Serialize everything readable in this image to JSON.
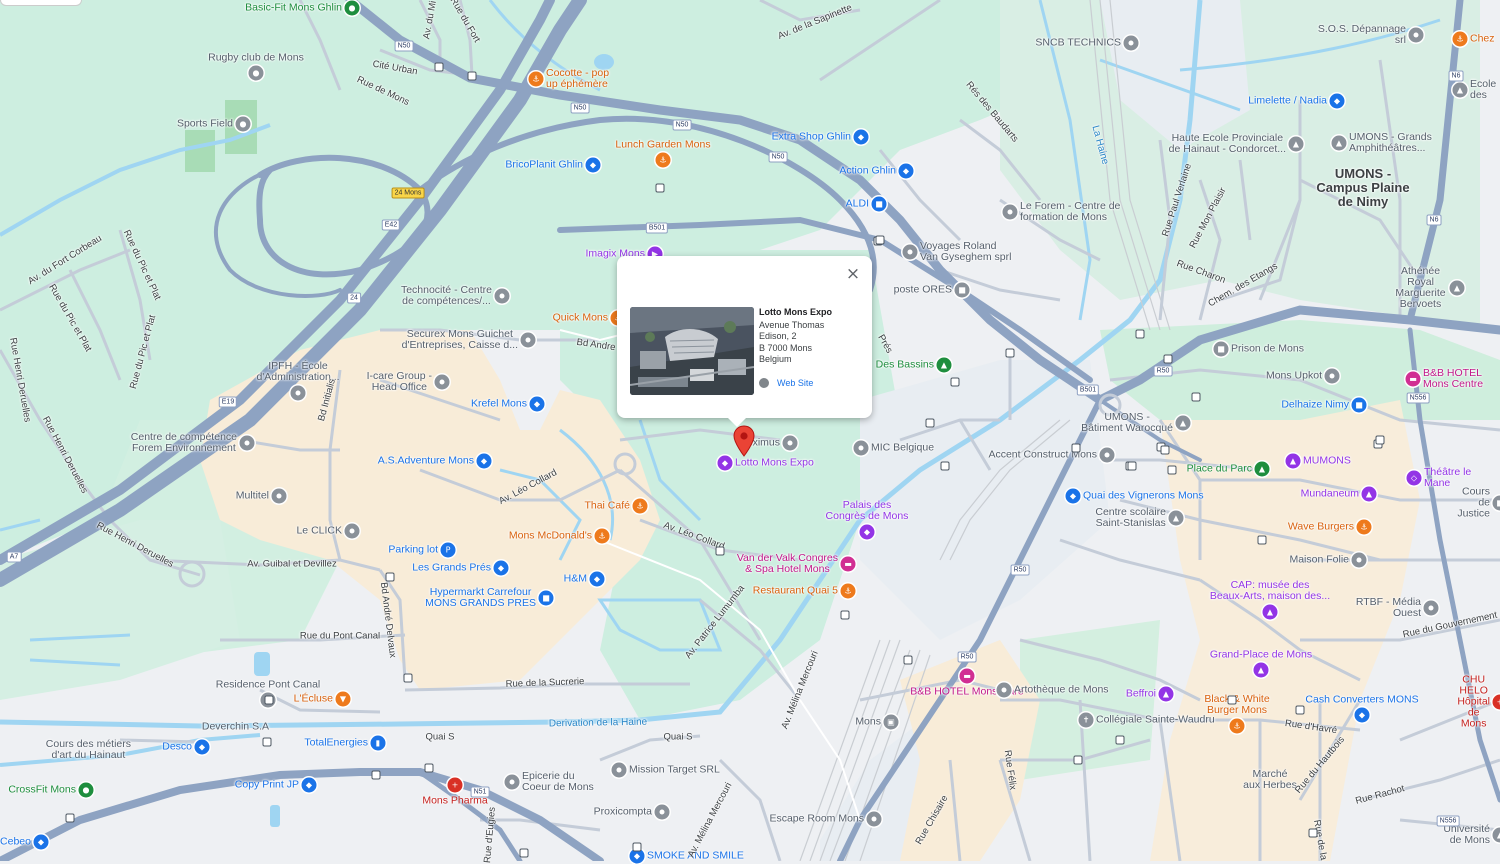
{
  "popup": {
    "title": "Lotto Mons Expo",
    "address_lines": [
      "Avenue Thomas",
      "Edison, 2",
      "B 7000 Mons",
      "Belgium"
    ],
    "web_label": "Web Site",
    "close_symbol": "×"
  },
  "pois": [
    {
      "id": "basic-fit",
      "text": [
        "Basic-Fit Mons Ghlin"
      ],
      "color": "green",
      "icon": "gym-icon"
    },
    {
      "id": "rugby",
      "text": [
        "Rugby club de Mons"
      ],
      "color": "gray",
      "icon": "sports-icon"
    },
    {
      "id": "sports-field",
      "text": [
        "Sports Field"
      ],
      "color": "gray",
      "icon": "sports-icon"
    },
    {
      "id": "cocotte",
      "text": [
        "Cocotte - pop",
        "up éphémère"
      ],
      "color": "orange",
      "icon": "restaurant-icon"
    },
    {
      "id": "lunch-garden",
      "text": [
        "Lunch Garden Mons"
      ],
      "color": "orange",
      "icon": "restaurant-icon"
    },
    {
      "id": "bricoplanit",
      "text": [
        "BricoPlanit Ghlin"
      ],
      "color": "blue",
      "icon": "shopping-icon"
    },
    {
      "id": "extra-shop",
      "text": [
        "Extra Shop Ghlin"
      ],
      "color": "blue",
      "icon": "shopping-icon"
    },
    {
      "id": "action-ghlin",
      "text": [
        "Action Ghlin"
      ],
      "color": "blue",
      "icon": "shopping-icon"
    },
    {
      "id": "aldi",
      "text": [
        "ALDI"
      ],
      "color": "blue",
      "icon": "cart-icon"
    },
    {
      "id": "sncb-technics",
      "text": [
        "SNCB TECHNICS"
      ],
      "color": "gray",
      "icon": "place-icon"
    },
    {
      "id": "sos-depannage",
      "text": [
        "S.O.S. Dépannage srl"
      ],
      "color": "gray",
      "icon": "place-icon"
    },
    {
      "id": "chez",
      "text": [
        "Chez"
      ],
      "color": "orange",
      "icon": "restaurant-icon"
    },
    {
      "id": "ecole",
      "text": [
        "Ecole",
        "des"
      ],
      "color": "gray",
      "icon": "school-icon"
    },
    {
      "id": "limelette",
      "text": [
        "Limelette / Nadia"
      ],
      "color": "blue",
      "icon": "shopping-icon"
    },
    {
      "id": "haute-ecole",
      "text": [
        "Haute Ecole Provinciale",
        "de Hainaut - Condorcet..."
      ],
      "color": "gray",
      "icon": "school-icon"
    },
    {
      "id": "umons-grands",
      "text": [
        "UMONS - Grands",
        "Amphithéâtres..."
      ],
      "color": "gray",
      "icon": "school-icon"
    },
    {
      "id": "le-forem",
      "text": [
        "Le Forem - Centre de",
        "formation de Mons"
      ],
      "color": "gray",
      "icon": "place-icon"
    },
    {
      "id": "voyages-roland",
      "text": [
        "Voyages Roland",
        "Van Gyseghem sprl"
      ],
      "color": "gray",
      "icon": "place-icon"
    },
    {
      "id": "imagix",
      "text": [
        "Imagix Mons"
      ],
      "color": "purple",
      "icon": "cinema-icon"
    },
    {
      "id": "poste-ores",
      "text": [
        "poste ORES"
      ],
      "color": "gray",
      "icon": "building-icon"
    },
    {
      "id": "athenee",
      "text": [
        "Athénée Royal",
        "Marguerite Bervoets"
      ],
      "color": "gray",
      "icon": "school-icon"
    },
    {
      "id": "technocite",
      "text": [
        "Technocité - Centre",
        "de compétences/..."
      ],
      "color": "gray",
      "icon": "place-icon"
    },
    {
      "id": "quick",
      "text": [
        "Quick Mons"
      ],
      "color": "orange",
      "icon": "restaurant-icon"
    },
    {
      "id": "securex",
      "text": [
        "Securex Mons Guichet",
        "d'Entreprises, Caisse d..."
      ],
      "color": "gray",
      "icon": "place-icon"
    },
    {
      "id": "ipfh",
      "text": [
        "IPFH - École",
        "d'Administration..."
      ],
      "color": "gray",
      "icon": "place-icon"
    },
    {
      "id": "icare",
      "text": [
        "I-care Group -",
        "Head Office"
      ],
      "color": "gray",
      "icon": "place-icon"
    },
    {
      "id": "krefel",
      "text": [
        "Krefel Mons"
      ],
      "color": "blue",
      "icon": "shopping-icon"
    },
    {
      "id": "des-bassins",
      "text": [
        "Des Bassins"
      ],
      "color": "green",
      "icon": "park-icon"
    },
    {
      "id": "proximus",
      "text": [
        "Proximus"
      ],
      "color": "gray",
      "icon": "place-icon"
    },
    {
      "id": "mic",
      "text": [
        "MIC Belgique"
      ],
      "color": "gray",
      "icon": "place-icon"
    },
    {
      "id": "lotto",
      "text": [
        "Lotto Mons Expo"
      ],
      "color": "purple",
      "icon": "venue-icon"
    },
    {
      "id": "prison",
      "text": [
        "Prison de Mons"
      ],
      "color": "gray",
      "icon": "building-icon"
    },
    {
      "id": "mons-upkot",
      "text": [
        "Mons Upkot"
      ],
      "color": "gray",
      "icon": "place-icon"
    },
    {
      "id": "bb-centre",
      "text": [
        "B&B HOTEL",
        "Mons Centre"
      ],
      "color": "pink",
      "icon": "hotel-icon"
    },
    {
      "id": "delhaize",
      "text": [
        "Delhaize Nimy"
      ],
      "color": "blue",
      "icon": "cart-icon"
    },
    {
      "id": "umons-batiment",
      "text": [
        "UMONS -",
        "Bâtiment Warocqué"
      ],
      "color": "gray",
      "icon": "school-icon"
    },
    {
      "id": "accent",
      "text": [
        "Accent Construct Mons"
      ],
      "color": "gray",
      "icon": "place-icon"
    },
    {
      "id": "place-du-parc",
      "text": [
        "Place du Parc"
      ],
      "color": "green",
      "icon": "park-icon"
    },
    {
      "id": "mumons",
      "text": [
        "MUMONS"
      ],
      "color": "purple",
      "icon": "museum-icon"
    },
    {
      "id": "theatre",
      "text": [
        "Théâtre le Mane"
      ],
      "color": "purple",
      "icon": "theatre-icon"
    },
    {
      "id": "quai-vignerons",
      "text": [
        "Quai des Vignerons Mons"
      ],
      "color": "blue",
      "icon": "shopping-icon"
    },
    {
      "id": "mundaneum",
      "text": [
        "Mundaneum"
      ],
      "color": "purple",
      "icon": "museum-icon"
    },
    {
      "id": "cours-justice",
      "text": [
        "Cours de Justice"
      ],
      "color": "gray",
      "icon": "building-icon"
    },
    {
      "id": "centre-scolaire",
      "text": [
        "Centre scolaire",
        "Saint-Stanislas"
      ],
      "color": "gray",
      "icon": "school-icon"
    },
    {
      "id": "wave-burgers",
      "text": [
        "Wave Burgers"
      ],
      "color": "orange",
      "icon": "restaurant-icon"
    },
    {
      "id": "maison-folie",
      "text": [
        "Maison Folie"
      ],
      "color": "gray",
      "icon": "place-icon"
    },
    {
      "id": "centre-comp",
      "text": [
        "Centre de compétence",
        "Forem Environnement"
      ],
      "color": "gray",
      "icon": "place-icon"
    },
    {
      "id": "as-adventure",
      "text": [
        "A.S.Adventure Mons"
      ],
      "color": "blue",
      "icon": "shopping-icon"
    },
    {
      "id": "multitel",
      "text": [
        "Multitel"
      ],
      "color": "gray",
      "icon": "place-icon"
    },
    {
      "id": "thai-cafe",
      "text": [
        "Thai Café"
      ],
      "color": "orange",
      "icon": "restaurant-icon"
    },
    {
      "id": "le-click",
      "text": [
        "Le CLICK"
      ],
      "color": "gray",
      "icon": "place-icon"
    },
    {
      "id": "mcdonalds",
      "text": [
        "Mons McDonald's"
      ],
      "color": "orange",
      "icon": "restaurant-icon"
    },
    {
      "id": "palais-congres",
      "text": [
        "Palais des",
        "Congrès de Mons"
      ],
      "color": "purple",
      "icon": "venue-icon"
    },
    {
      "id": "parking",
      "text": [
        "Parking lot"
      ],
      "color": "blue",
      "icon": "parking-icon"
    },
    {
      "id": "grands-pres",
      "text": [
        "Les Grands Prés"
      ],
      "color": "blue",
      "icon": "shopping-icon"
    },
    {
      "id": "hm",
      "text": [
        "H&M"
      ],
      "color": "blue",
      "icon": "shopping-icon"
    },
    {
      "id": "carrefour",
      "text": [
        "Hypermarkt Carrefour",
        "MONS GRANDS PRES"
      ],
      "color": "blue",
      "icon": "cart-icon"
    },
    {
      "id": "van-der-valk",
      "text": [
        "Van der Valk Congres",
        "& Spa Hotel Mons"
      ],
      "color": "pink",
      "icon": "hotel-icon"
    },
    {
      "id": "restaurant-quai5",
      "text": [
        "Restaurant Quai 5"
      ],
      "color": "orange",
      "icon": "restaurant-icon"
    },
    {
      "id": "cap-musee",
      "text": [
        "CAP: musée des",
        "Beaux-Arts, maison des..."
      ],
      "color": "purple",
      "icon": "museum-icon"
    },
    {
      "id": "rtbf",
      "text": [
        "RTBF - Média Ouest"
      ],
      "color": "gray",
      "icon": "place-icon"
    },
    {
      "id": "residence",
      "text": [
        "Residence Pont Canal"
      ],
      "color": "gray",
      "icon": "place-icon"
    },
    {
      "id": "lecluse",
      "text": [
        "L'Écluse"
      ],
      "color": "orange",
      "icon": "bar-icon"
    },
    {
      "id": "grand-place",
      "text": [
        "Grand-Place de Mons"
      ],
      "color": "purple",
      "icon": "landmark-icon"
    },
    {
      "id": "bb-gare",
      "text": [
        "B&B HOTEL Mons Gare"
      ],
      "color": "pink",
      "icon": "hotel-icon"
    },
    {
      "id": "artotheque",
      "text": [
        "Artothèque de Mons"
      ],
      "color": "gray",
      "icon": "place-icon"
    },
    {
      "id": "beffroi",
      "text": [
        "Beffroi"
      ],
      "color": "purple",
      "icon": "landmark-icon"
    },
    {
      "id": "black-white",
      "text": [
        "Black & White",
        "Burger Mons"
      ],
      "color": "orange",
      "icon": "restaurant-icon"
    },
    {
      "id": "cash-converters",
      "text": [
        "Cash Converters MONS"
      ],
      "color": "blue",
      "icon": "shopping-icon"
    },
    {
      "id": "chu",
      "text": [
        "CHU HELO",
        "Hôpital de Mons"
      ],
      "color": "red",
      "icon": "hospital-icon"
    },
    {
      "id": "deverchin",
      "text": [
        "Deverchin S.A"
      ],
      "color": "teal",
      "icon": "place-icon"
    },
    {
      "id": "totalenergies",
      "text": [
        "TotalEnergies"
      ],
      "color": "blue",
      "icon": "gas-station-icon"
    },
    {
      "id": "cours-metiers",
      "text": [
        "Cours des métiers",
        "d'art du Hainaut"
      ],
      "color": "gray",
      "icon": "place-icon"
    },
    {
      "id": "desco",
      "text": [
        "Desco"
      ],
      "color": "blue",
      "icon": "shopping-icon"
    },
    {
      "id": "mons-station",
      "text": [
        "Mons"
      ],
      "color": "gray",
      "icon": "train-icon"
    },
    {
      "id": "collegiale",
      "text": [
        "Collégiale Sainte-Waudru"
      ],
      "color": "gray",
      "icon": "church-icon"
    },
    {
      "id": "mission-target",
      "text": [
        "Mission Target SRL"
      ],
      "color": "gray",
      "icon": "place-icon"
    },
    {
      "id": "epicerie",
      "text": [
        "Epicerie du",
        "Coeur de Mons"
      ],
      "color": "gray",
      "icon": "place-icon"
    },
    {
      "id": "crossfit",
      "text": [
        "CrossFit Mons"
      ],
      "color": "green",
      "icon": "gym-icon"
    },
    {
      "id": "copy-print",
      "text": [
        "Copy Print JP"
      ],
      "color": "blue",
      "icon": "shopping-icon"
    },
    {
      "id": "mons-pharma",
      "text": [
        "Mons Pharma"
      ],
      "color": "red",
      "icon": "pharmacy-icon"
    },
    {
      "id": "proxicompta",
      "text": [
        "Proxicompta"
      ],
      "color": "gray",
      "icon": "place-icon"
    },
    {
      "id": "escape-room",
      "text": [
        "Escape Room Mons"
      ],
      "color": "gray",
      "icon": "place-icon"
    },
    {
      "id": "marche-herbes",
      "text": [
        "Marché",
        "aux Herbes"
      ],
      "color": "gray",
      "icon": "place-icon"
    },
    {
      "id": "universite",
      "text": [
        "Université de Mons"
      ],
      "color": "gray",
      "icon": "school-icon"
    },
    {
      "id": "cebeo",
      "text": [
        "Cebeo"
      ],
      "color": "blue",
      "icon": "shopping-icon"
    },
    {
      "id": "smoke-smile",
      "text": [
        "SMOKE AND SMILE"
      ],
      "color": "blue",
      "icon": "shopping-icon"
    }
  ],
  "areas": [
    {
      "id": "umons-campus",
      "text": [
        "UMONS -",
        "Campus Plaine",
        "de Nimy"
      ]
    }
  ],
  "roads": [
    {
      "id": "rue-du-fort",
      "text": "Rue du Fort"
    },
    {
      "id": "av-milan",
      "text": "Av. du Mi"
    },
    {
      "id": "cite-urban",
      "text": "Cité Urban"
    },
    {
      "id": "rue-de-mons",
      "text": "Rue de Mons"
    },
    {
      "id": "av-sapinette",
      "text": "Av. de la Sapinette"
    },
    {
      "id": "res-baudarts",
      "text": "Rés des Baudarts"
    },
    {
      "id": "av-fort-corbeau",
      "text": "Av. du Fort Corbeau"
    },
    {
      "id": "rue-pic-plat-1",
      "text": "Rue du Pic et Plat"
    },
    {
      "id": "rue-pic-plat-2",
      "text": "Rue du Pic et Plat"
    },
    {
      "id": "rue-pic-plat-3",
      "text": "Rue du Pic et Plat"
    },
    {
      "id": "rue-henri-1",
      "text": "Rue Henri Deruelles"
    },
    {
      "id": "rue-henri-2",
      "text": "Rue Henri Deruelles"
    },
    {
      "id": "rue-henri-3",
      "text": "Rue Henri Deruelles"
    },
    {
      "id": "bd-initialis",
      "text": "Bd Initialis"
    },
    {
      "id": "bd-andre",
      "text": "Bd Andre"
    },
    {
      "id": "av-leo-collard",
      "text": "Av. Léo Collard"
    },
    {
      "id": "av-leo-collard-2",
      "text": "Av. Léo Collard"
    },
    {
      "id": "av-guibal",
      "text": "Av. Guibal et Devillez"
    },
    {
      "id": "bd-andre-delvaux",
      "text": "Bd André Delvaux"
    },
    {
      "id": "rue-pont-canal",
      "text": "Rue du Pont Canal"
    },
    {
      "id": "rue-sucrerie",
      "text": "Rue de la Sucrerie"
    },
    {
      "id": "av-patrice",
      "text": "Av. Patrice Lumumba"
    },
    {
      "id": "av-melina-1",
      "text": "Av. Mélina Mercouri"
    },
    {
      "id": "av-melina-2",
      "text": "Av. Mélina Mercouri"
    },
    {
      "id": "quai-s-1",
      "text": "Quai S"
    },
    {
      "id": "quai-s-2",
      "text": "Quai S"
    },
    {
      "id": "rue-paul-verlaine",
      "text": "Rue Paul Verlaine"
    },
    {
      "id": "rue-mon-plaisir",
      "text": "Rue Mon Plaisir"
    },
    {
      "id": "rue-charon",
      "text": "Rue Charon"
    },
    {
      "id": "chem-etangs",
      "text": "Chem. des Etangs"
    },
    {
      "id": "rue-gouvernement",
      "text": "Rue du Gouvernement"
    },
    {
      "id": "rue-havre",
      "text": "Rue d'Havré"
    },
    {
      "id": "rue-hautbois",
      "text": "Rue du Hautbois"
    },
    {
      "id": "rue-rachot",
      "text": "Rue Rachot"
    },
    {
      "id": "rue-felix",
      "text": "Rue Félix"
    },
    {
      "id": "rue-chisaire",
      "text": "Rue Chisaire"
    },
    {
      "id": "rue-de-la",
      "text": "Rue de la"
    },
    {
      "id": "rue-d-eugies",
      "text": "Rue d'Eugies"
    },
    {
      "id": "pres",
      "text": "Prés"
    }
  ],
  "water": [
    {
      "id": "la-haine",
      "text": "La Haine"
    },
    {
      "id": "derivation",
      "text": "Derivation de la Haine"
    }
  ],
  "shields": [
    {
      "id": "n50-1",
      "text": "N50"
    },
    {
      "id": "n50-2",
      "text": "N50"
    },
    {
      "id": "n50-3",
      "text": "N50"
    },
    {
      "id": "n50-4",
      "text": "N50"
    },
    {
      "id": "b501-1",
      "text": "B501"
    },
    {
      "id": "b501-2",
      "text": "B501"
    },
    {
      "id": "e42",
      "text": "E42"
    },
    {
      "id": "e19",
      "text": "E19"
    },
    {
      "id": "a7",
      "text": "A7"
    },
    {
      "id": "n6-1",
      "text": "N6"
    },
    {
      "id": "n6-2",
      "text": "N6"
    },
    {
      "id": "r50-1",
      "text": "R50"
    },
    {
      "id": "r50-2",
      "text": "R50"
    },
    {
      "id": "r50-3",
      "text": "R50"
    },
    {
      "id": "n556-1",
      "text": "N556"
    },
    {
      "id": "n556-2",
      "text": "N556"
    },
    {
      "id": "n51",
      "text": "N51"
    },
    {
      "id": "e24-mons",
      "text": "24 Mons"
    },
    {
      "id": "e24",
      "text": "24"
    }
  ]
}
